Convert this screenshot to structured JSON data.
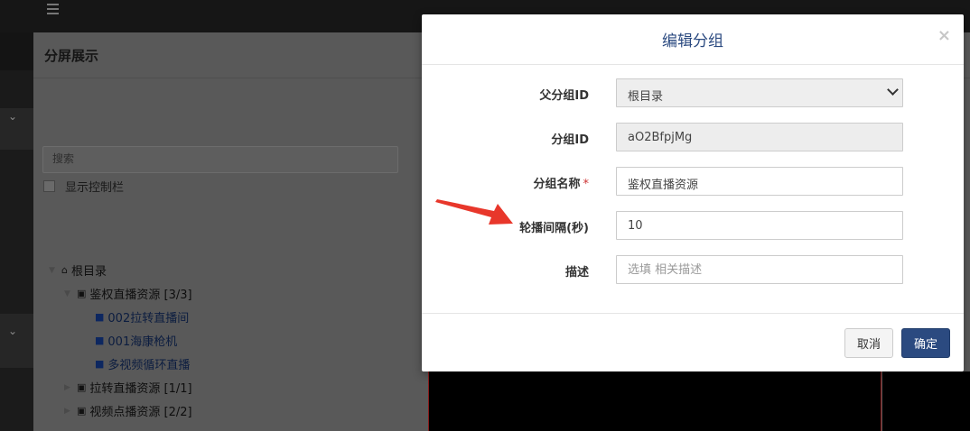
{
  "app": {
    "panel_title": "分屏展示",
    "search_placeholder": "搜索",
    "show_controls_label": "显示控制栏"
  },
  "tree": {
    "root": "根目录",
    "groups": [
      {
        "label": "鉴权直播资源 [3/3]",
        "expanded": true,
        "children": [
          "002拉转直播间",
          "001海康枪机",
          "多视频循环直播"
        ]
      },
      {
        "label": "拉转直播资源 [1/1]",
        "expanded": false
      },
      {
        "label": "视频点播资源 [2/2]",
        "expanded": false
      }
    ]
  },
  "modal": {
    "title": "编辑分组",
    "close_symbol": "×",
    "fields": {
      "parent_id": {
        "label": "父分组ID",
        "value": "根目录"
      },
      "group_id": {
        "label": "分组ID",
        "value": "aO2BfpjMg"
      },
      "group_name": {
        "label": "分组名称",
        "required_mark": "*",
        "value": "鉴权直播资源"
      },
      "interval": {
        "label": "轮播间隔(秒)",
        "value": "10"
      },
      "description": {
        "label": "描述",
        "placeholder": "选填 相关描述"
      }
    },
    "cancel_label": "取消",
    "ok_label": "确定"
  },
  "colors": {
    "accent": "#2b4a80",
    "annotation_arrow": "#e8372b",
    "overlay": "#595959"
  },
  "icons": {
    "menu": "menu-icon",
    "home": "home-icon",
    "sitemap": "sitemap-icon",
    "video": "video-camera-icon",
    "close": "close-icon",
    "dropdown": "chevron-down-icon"
  }
}
